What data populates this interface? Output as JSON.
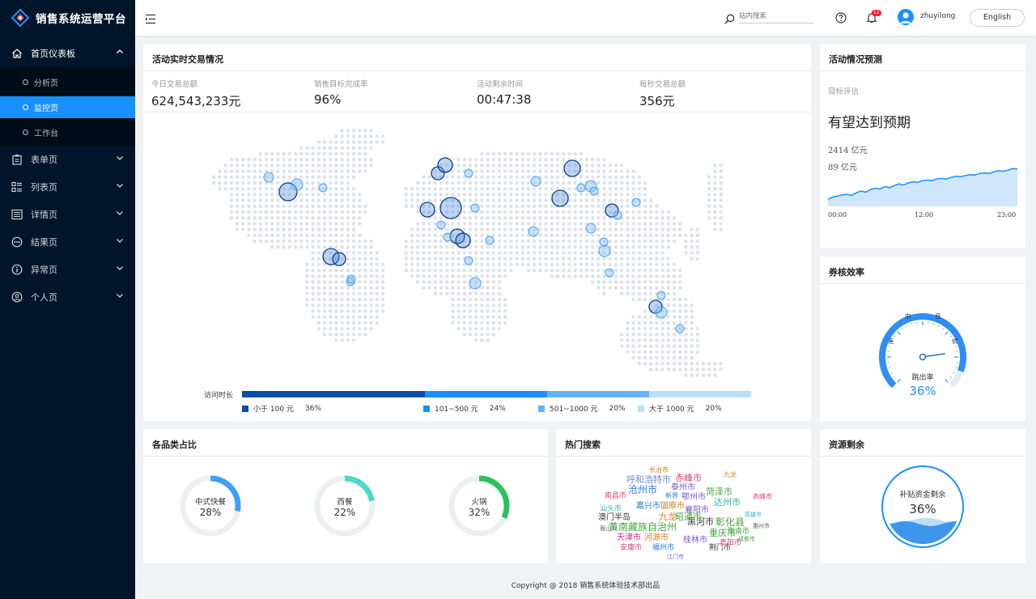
{
  "app": {
    "title": "销售系统运营平台"
  },
  "sidebar": {
    "dashboard": {
      "label": "首页仪表板",
      "subitems": [
        {
          "label": "分析页"
        },
        {
          "label": "监控页"
        },
        {
          "label": "工作台"
        }
      ]
    },
    "items": [
      {
        "label": "表单页"
      },
      {
        "label": "列表页"
      },
      {
        "label": "详情页"
      },
      {
        "label": "结果页"
      },
      {
        "label": "异常页"
      },
      {
        "label": "个人页"
      }
    ]
  },
  "header": {
    "search_placeholder": "站内搜索",
    "notification_count": "12",
    "username": "zhuyilong",
    "lang_button": "English"
  },
  "realtime": {
    "title": "活动实时交易情况",
    "stats": [
      {
        "label": "今日交易总额",
        "value": "624,543,233元"
      },
      {
        "label": "销售目标完成率",
        "value": "96%"
      },
      {
        "label": "活动剩余时间",
        "value": "00:47:38"
      },
      {
        "label": "每秒交易总额",
        "value": "356元"
      }
    ],
    "legend_title": "访问时长",
    "legend": [
      {
        "label": "小于 100 元",
        "pct": "36%",
        "color": "#0a4ea8",
        "fraction": 0.36
      },
      {
        "label": "101~500 元",
        "pct": "24%",
        "color": "#1890ff",
        "fraction": 0.24
      },
      {
        "label": "501~1000 元",
        "pct": "20%",
        "color": "#62b4f4",
        "fraction": 0.2
      },
      {
        "label": "大于 1000 元",
        "pct": "20%",
        "color": "#b9e0fb",
        "fraction": 0.2
      }
    ]
  },
  "forecast": {
    "title": "活动情况预测",
    "label": "目标评估",
    "headline": "有望达到预期",
    "values": [
      "2414 亿元",
      "89 亿元"
    ],
    "x_labels": [
      "00:00",
      "12:00",
      "23:00"
    ],
    "chart_data": {
      "type": "area",
      "x": [
        "00:00",
        "12:00",
        "23:00"
      ],
      "values": [
        10,
        14,
        16,
        18,
        19,
        17,
        22,
        25,
        23,
        28,
        30,
        29,
        33,
        31,
        35,
        38,
        36,
        40,
        42,
        41,
        44,
        45,
        44,
        47,
        48,
        47,
        50,
        52,
        51,
        53,
        55,
        54,
        57,
        58,
        57,
        60,
        62,
        61,
        63,
        66,
        65
      ]
    }
  },
  "efficiency": {
    "title": "券核效率",
    "labels": [
      "中",
      "良",
      "差",
      "优"
    ],
    "caption": "跳出率",
    "value": "36%",
    "fraction": 0.36
  },
  "category": {
    "title": "各品类占比",
    "items": [
      {
        "label": "中式快餐",
        "value": "28%",
        "fraction": 0.28,
        "color": "#40a0f7"
      },
      {
        "label": "西餐",
        "value": "22%",
        "fraction": 0.22,
        "color": "#4fd8c5"
      },
      {
        "label": "火锅",
        "value": "32%",
        "fraction": 0.32,
        "color": "#2bc25d"
      }
    ]
  },
  "hot": {
    "title": "热门搜索",
    "words": [
      {
        "text": "黄南藏族自治州",
        "color": "#4aa33f",
        "size": 12
      },
      {
        "text": "呼和浩特市",
        "color": "#6a8ad0",
        "size": 11
      },
      {
        "text": "沧州市",
        "color": "#2a7bd6",
        "size": 12
      },
      {
        "text": "赤峰市",
        "color": "#e0426b",
        "size": 11
      },
      {
        "text": "泰州市",
        "color": "#7a5cc2",
        "size": 10
      },
      {
        "text": "菏泽市",
        "color": "#4aa33f",
        "size": 11
      },
      {
        "text": "达州市",
        "color": "#2bb5b0",
        "size": 11
      },
      {
        "text": "鄂州市",
        "color": "#7a5cc2",
        "size": 10
      },
      {
        "text": "彰化县",
        "color": "#4aa33f",
        "size": 12
      },
      {
        "text": "重庆市",
        "color": "#4aa33f",
        "size": 11
      },
      {
        "text": "黑河市",
        "color": "#333",
        "size": 11
      },
      {
        "text": "固原市",
        "color": "#c77c25",
        "size": 10
      },
      {
        "text": "嘉兴市",
        "color": "#2a7bd6",
        "size": 10
      },
      {
        "text": "襄阳市",
        "color": "#7a5cc2",
        "size": 10
      },
      {
        "text": "澳门半岛",
        "color": "#333",
        "size": 10
      },
      {
        "text": "九龙",
        "color": "#e07b20",
        "size": 11
      },
      {
        "text": "昭通市",
        "color": "#4aa33f",
        "size": 11
      },
      {
        "text": "南昌市",
        "color": "#e0426b",
        "size": 9
      },
      {
        "text": "汕头市",
        "color": "#2bb5b0",
        "size": 9
      },
      {
        "text": "天津市",
        "color": "#c7268b",
        "size": 10
      },
      {
        "text": "河源市",
        "color": "#e07b20",
        "size": 10
      },
      {
        "text": "桂林市",
        "color": "#7a5cc2",
        "size": 10
      },
      {
        "text": "安康市",
        "color": "#e0426b",
        "size": 9
      },
      {
        "text": "福州市",
        "color": "#2a7bd6",
        "size": 9
      },
      {
        "text": "荆门市",
        "color": "#333",
        "size": 9
      },
      {
        "text": "贵阳市",
        "color": "#e0426b",
        "size": 9
      },
      {
        "text": "陇南市",
        "color": "#4aa33f",
        "size": 9
      },
      {
        "text": "新界",
        "color": "#2a7bd6",
        "size": 8
      },
      {
        "text": "长治市",
        "color": "#c77c25",
        "size": 8
      },
      {
        "text": "九龙",
        "color": "#e07b20",
        "size": 8
      },
      {
        "text": "赤峰市",
        "color": "#e0426b",
        "size": 8
      },
      {
        "text": "眉山市",
        "color": "#666",
        "size": 7
      },
      {
        "text": "成都市",
        "color": "#4aa33f",
        "size": 7
      },
      {
        "text": "江门市",
        "color": "#7a5cc2",
        "size": 7
      },
      {
        "text": "高雄市",
        "color": "#2bb5b0",
        "size": 7
      },
      {
        "text": "惠州市",
        "color": "#666",
        "size": 7
      }
    ]
  },
  "resource": {
    "title": "资源剩余",
    "label": "补贴资金剩余",
    "value": "36%",
    "fraction": 0.36
  },
  "footer": {
    "text": "Copyright @ 2018 销售系统体验技术部出品"
  }
}
